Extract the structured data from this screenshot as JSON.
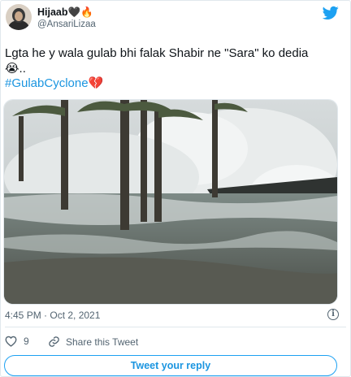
{
  "author": {
    "display_name": "Hijaab",
    "name_emojis": "🖤🔥",
    "handle": "@AnsariLizaa"
  },
  "tweet": {
    "text_line1": "Lgta he y wala gulab bhi falak Shabir ne \"Sara\" ko dedia",
    "text_line2_emoji": "😭",
    "text_line2_suffix": "..",
    "hashtag": "#GulabCyclone",
    "hashtag_emoji": "💔",
    "timestamp": "4:45 PM · Oct 2, 2021"
  },
  "actions": {
    "like_count": "9",
    "copy_link_label": "Share this Tweet",
    "reply_button_label": "Tweet your reply"
  },
  "icons": {
    "logo": "twitter-bird-icon",
    "info": "info-icon",
    "like": "heart-icon",
    "share": "link-icon"
  },
  "colors": {
    "brand": "#1da1f2",
    "link": "#1b95e0",
    "secondary_text": "#536471",
    "border": "#e1e8ed"
  }
}
